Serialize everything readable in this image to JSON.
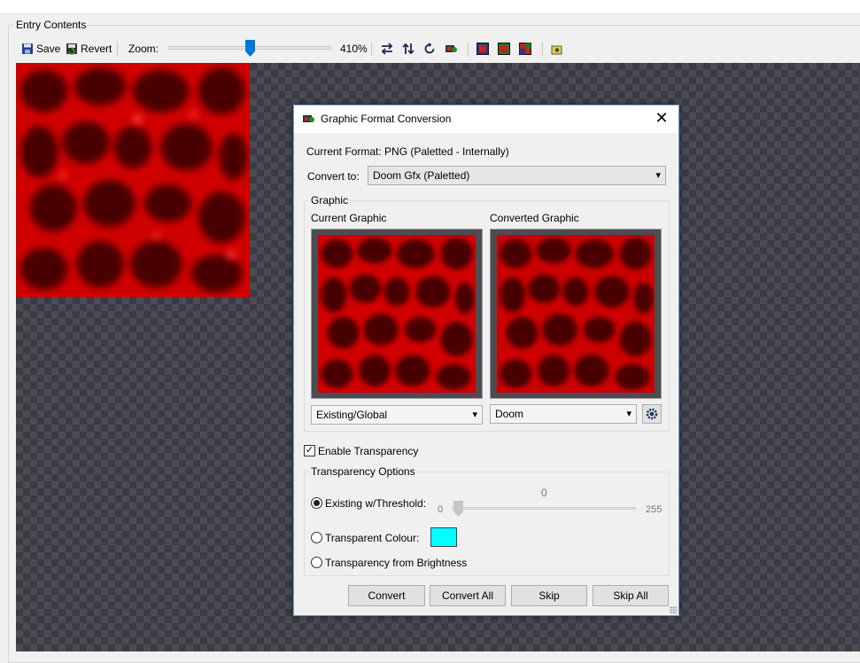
{
  "panel": {
    "title": "Entry Contents"
  },
  "toolbar": {
    "save_label": "Save",
    "revert_label": "Revert",
    "zoom_label": "Zoom:",
    "zoom_value": "410%",
    "zoom_level": 0.5
  },
  "dialog": {
    "title": "Graphic Format Conversion",
    "current_format": "Current Format: PNG (Paletted - Internally)",
    "convert_to_label": "Convert to:",
    "convert_to_value": "Doom Gfx (Paletted)",
    "graphic_group_label": "Graphic",
    "current_graphic_label": "Current Graphic",
    "converted_graphic_label": "Converted Graphic",
    "current_palette_value": "Existing/Global",
    "target_palette_value": "Doom",
    "enable_transparency_label": "Enable Transparency",
    "enable_transparency_checked": true,
    "transparency_group_label": "Transparency Options",
    "threshold_option_label": "Existing w/Threshold:",
    "threshold_value": "0",
    "threshold_min": "0",
    "threshold_max": "255",
    "transparent_colour_label": "Transparent Colour:",
    "transparent_colour": "#00ffff",
    "brightness_option_label": "Transparency from Brightness",
    "buttons": {
      "convert": "Convert",
      "convert_all": "Convert All",
      "skip": "Skip",
      "skip_all": "Skip All"
    }
  },
  "icons": [
    "save-icon",
    "revert-icon",
    "swap-horizontal-icon",
    "swap-vertical-icon",
    "rotate-icon",
    "colour-remap-icon",
    "palette-red-icon",
    "palette-green-icon",
    "palette-mixed-icon",
    "settings-icon",
    "gear-icon",
    "close-icon",
    "dialog-app-icon"
  ]
}
